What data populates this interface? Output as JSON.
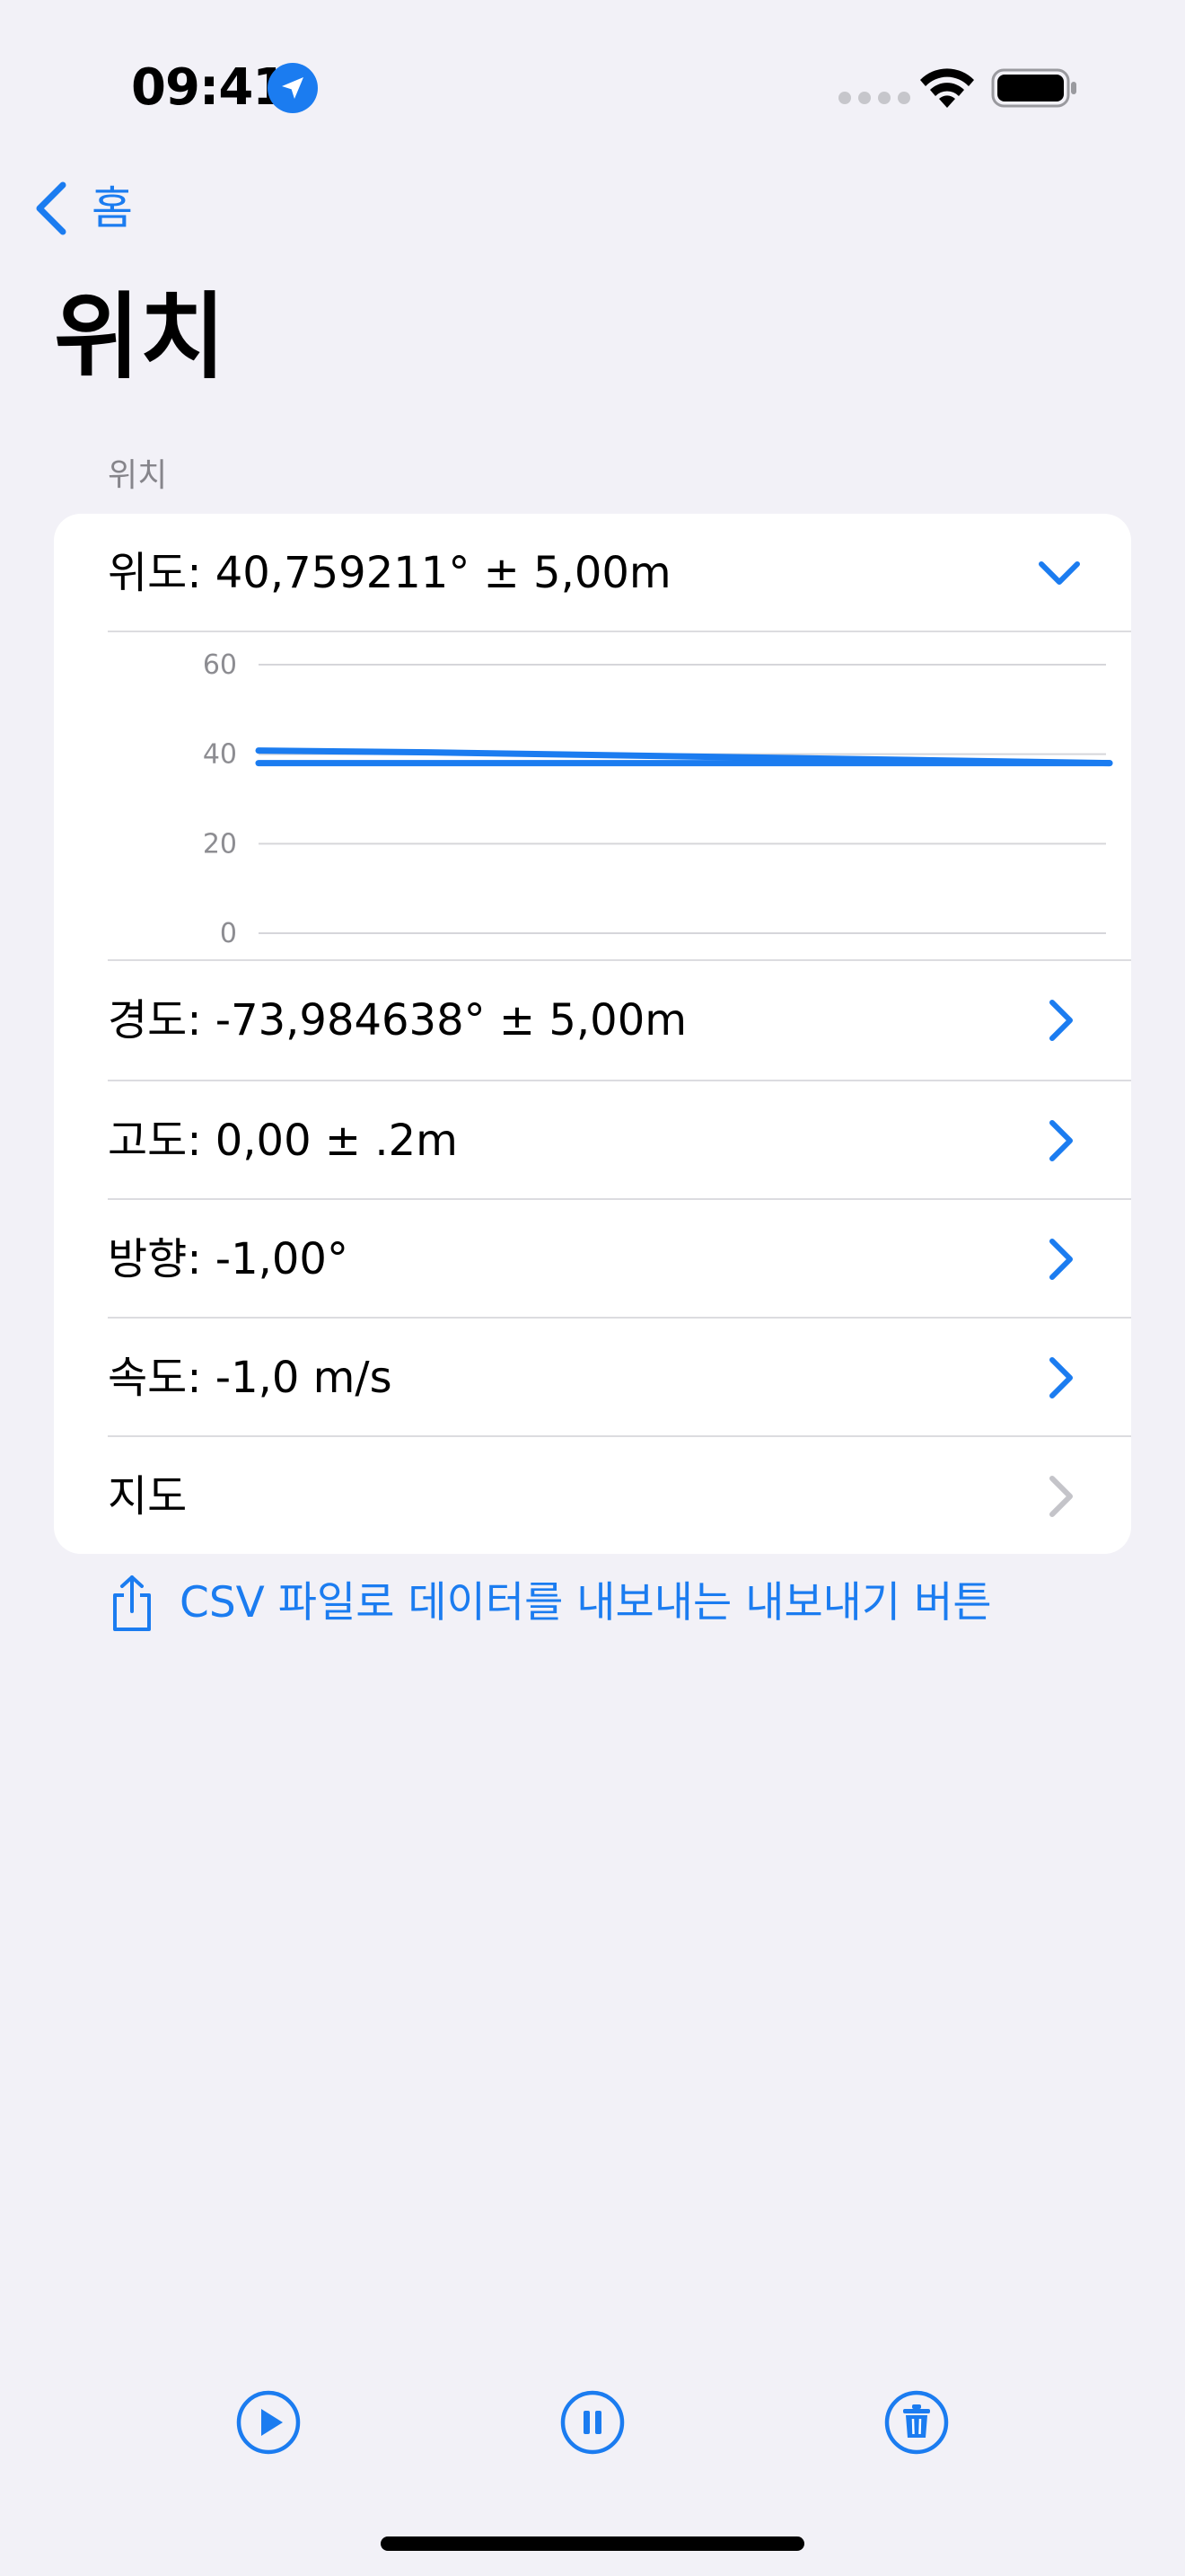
{
  "status_bar": {
    "time": "09:41",
    "location_icon": "location-arrow-icon",
    "signal_icon": "signal-dots-icon",
    "wifi_icon": "wifi-icon",
    "battery_icon": "battery-full-icon"
  },
  "nav": {
    "back_label": "홈",
    "back_icon": "chevron-left-icon"
  },
  "page": {
    "title": "위치"
  },
  "section": {
    "header": "위치",
    "rows": [
      {
        "label": "위도: 40,759211° ± 5,00m",
        "icon": "chevron-down-icon",
        "expanded": true
      },
      {
        "label": "경도: -73,984638° ± 5,00m",
        "icon": "chevron-right-icon"
      },
      {
        "label": "고도: 0,00 ± .2m",
        "icon": "chevron-right-icon"
      },
      {
        "label": "방향: -1,00°",
        "icon": "chevron-right-icon"
      },
      {
        "label": "속도: -1,0 m/s",
        "icon": "chevron-right-icon"
      },
      {
        "label": "지도",
        "icon": "chevron-right-icon",
        "disabled": true
      }
    ]
  },
  "chart_data": {
    "type": "line",
    "ylim": [
      0,
      60
    ],
    "yticks": [
      "60",
      "40",
      "20",
      "0"
    ],
    "x": [
      0,
      1,
      2,
      3,
      4,
      5,
      6,
      7,
      8,
      9,
      10
    ],
    "series": [
      {
        "values": [
          40.8,
          40.6,
          40.4,
          40.1,
          39.8,
          39.5,
          39.2,
          38.9,
          38.6,
          38.3,
          38.0
        ]
      },
      {
        "values": [
          38.0,
          38.0,
          38.0,
          38.0,
          38.0,
          38.0,
          38.0,
          38.0,
          38.0,
          38.0,
          38.0
        ]
      }
    ],
    "line_color": "#1b7cf0",
    "grid": true
  },
  "export": {
    "label": "CSV 파일로 데이터를 내보내는 내보내기 버튼",
    "icon": "share-icon"
  },
  "toolbar": {
    "play_icon": "play-circle-icon",
    "pause_icon": "pause-circle-icon",
    "trash_icon": "trash-circle-icon"
  },
  "colors": {
    "accent": "#1b7cf0",
    "background": "#f2f1f7",
    "card": "#ffffff",
    "secondary_text": "#86858b",
    "disabled_chevron": "#c4c4c9"
  }
}
